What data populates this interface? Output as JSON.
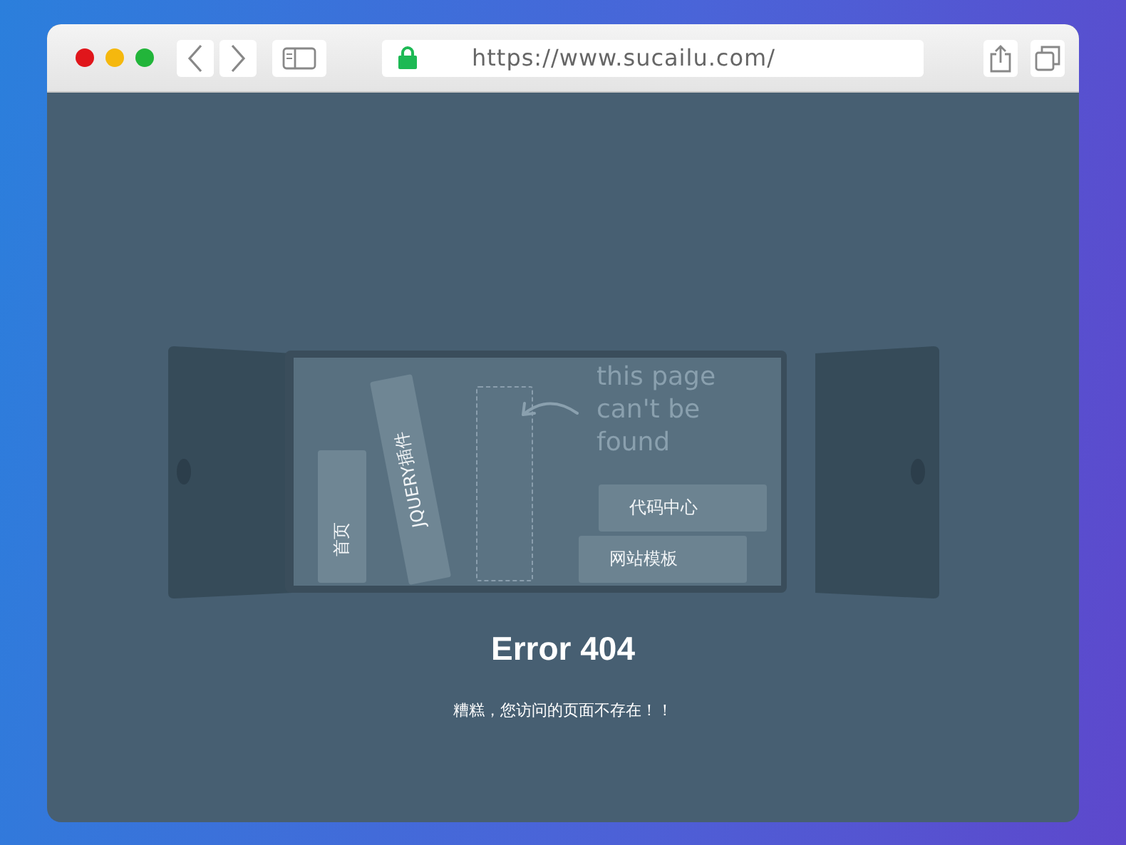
{
  "browser": {
    "url": "https://www.sucailu.com/"
  },
  "shelf": {
    "note": "this page can't be found",
    "items": [
      {
        "kind": "upright",
        "label": "首页"
      },
      {
        "kind": "leaning",
        "label": "JQUERY插件"
      },
      {
        "kind": "missing"
      },
      {
        "kind": "lying",
        "label": "代码中心"
      },
      {
        "kind": "lying",
        "label": "网站模板"
      }
    ]
  },
  "error": {
    "title": "Error 404",
    "message": "糟糕，您访问的页面不存在！！"
  }
}
